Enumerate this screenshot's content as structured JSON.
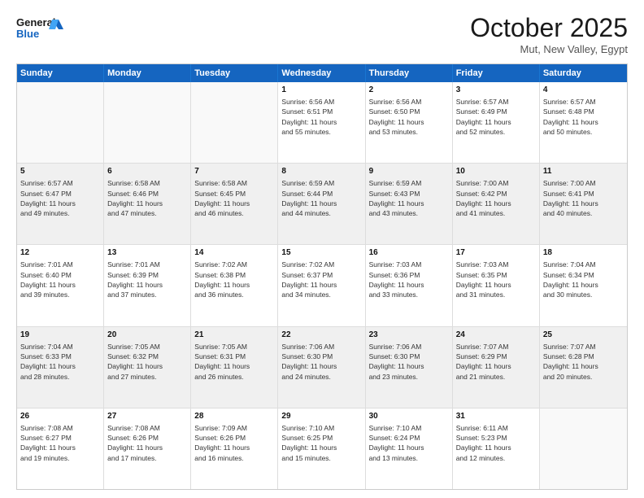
{
  "header": {
    "logo_line1": "General",
    "logo_line2": "Blue",
    "month": "October 2025",
    "location": "Mut, New Valley, Egypt"
  },
  "days_of_week": [
    "Sunday",
    "Monday",
    "Tuesday",
    "Wednesday",
    "Thursday",
    "Friday",
    "Saturday"
  ],
  "weeks": [
    [
      {
        "day": "",
        "text": ""
      },
      {
        "day": "",
        "text": ""
      },
      {
        "day": "",
        "text": ""
      },
      {
        "day": "1",
        "text": "Sunrise: 6:56 AM\nSunset: 6:51 PM\nDaylight: 11 hours\nand 55 minutes."
      },
      {
        "day": "2",
        "text": "Sunrise: 6:56 AM\nSunset: 6:50 PM\nDaylight: 11 hours\nand 53 minutes."
      },
      {
        "day": "3",
        "text": "Sunrise: 6:57 AM\nSunset: 6:49 PM\nDaylight: 11 hours\nand 52 minutes."
      },
      {
        "day": "4",
        "text": "Sunrise: 6:57 AM\nSunset: 6:48 PM\nDaylight: 11 hours\nand 50 minutes."
      }
    ],
    [
      {
        "day": "5",
        "text": "Sunrise: 6:57 AM\nSunset: 6:47 PM\nDaylight: 11 hours\nand 49 minutes."
      },
      {
        "day": "6",
        "text": "Sunrise: 6:58 AM\nSunset: 6:46 PM\nDaylight: 11 hours\nand 47 minutes."
      },
      {
        "day": "7",
        "text": "Sunrise: 6:58 AM\nSunset: 6:45 PM\nDaylight: 11 hours\nand 46 minutes."
      },
      {
        "day": "8",
        "text": "Sunrise: 6:59 AM\nSunset: 6:44 PM\nDaylight: 11 hours\nand 44 minutes."
      },
      {
        "day": "9",
        "text": "Sunrise: 6:59 AM\nSunset: 6:43 PM\nDaylight: 11 hours\nand 43 minutes."
      },
      {
        "day": "10",
        "text": "Sunrise: 7:00 AM\nSunset: 6:42 PM\nDaylight: 11 hours\nand 41 minutes."
      },
      {
        "day": "11",
        "text": "Sunrise: 7:00 AM\nSunset: 6:41 PM\nDaylight: 11 hours\nand 40 minutes."
      }
    ],
    [
      {
        "day": "12",
        "text": "Sunrise: 7:01 AM\nSunset: 6:40 PM\nDaylight: 11 hours\nand 39 minutes."
      },
      {
        "day": "13",
        "text": "Sunrise: 7:01 AM\nSunset: 6:39 PM\nDaylight: 11 hours\nand 37 minutes."
      },
      {
        "day": "14",
        "text": "Sunrise: 7:02 AM\nSunset: 6:38 PM\nDaylight: 11 hours\nand 36 minutes."
      },
      {
        "day": "15",
        "text": "Sunrise: 7:02 AM\nSunset: 6:37 PM\nDaylight: 11 hours\nand 34 minutes."
      },
      {
        "day": "16",
        "text": "Sunrise: 7:03 AM\nSunset: 6:36 PM\nDaylight: 11 hours\nand 33 minutes."
      },
      {
        "day": "17",
        "text": "Sunrise: 7:03 AM\nSunset: 6:35 PM\nDaylight: 11 hours\nand 31 minutes."
      },
      {
        "day": "18",
        "text": "Sunrise: 7:04 AM\nSunset: 6:34 PM\nDaylight: 11 hours\nand 30 minutes."
      }
    ],
    [
      {
        "day": "19",
        "text": "Sunrise: 7:04 AM\nSunset: 6:33 PM\nDaylight: 11 hours\nand 28 minutes."
      },
      {
        "day": "20",
        "text": "Sunrise: 7:05 AM\nSunset: 6:32 PM\nDaylight: 11 hours\nand 27 minutes."
      },
      {
        "day": "21",
        "text": "Sunrise: 7:05 AM\nSunset: 6:31 PM\nDaylight: 11 hours\nand 26 minutes."
      },
      {
        "day": "22",
        "text": "Sunrise: 7:06 AM\nSunset: 6:30 PM\nDaylight: 11 hours\nand 24 minutes."
      },
      {
        "day": "23",
        "text": "Sunrise: 7:06 AM\nSunset: 6:30 PM\nDaylight: 11 hours\nand 23 minutes."
      },
      {
        "day": "24",
        "text": "Sunrise: 7:07 AM\nSunset: 6:29 PM\nDaylight: 11 hours\nand 21 minutes."
      },
      {
        "day": "25",
        "text": "Sunrise: 7:07 AM\nSunset: 6:28 PM\nDaylight: 11 hours\nand 20 minutes."
      }
    ],
    [
      {
        "day": "26",
        "text": "Sunrise: 7:08 AM\nSunset: 6:27 PM\nDaylight: 11 hours\nand 19 minutes."
      },
      {
        "day": "27",
        "text": "Sunrise: 7:08 AM\nSunset: 6:26 PM\nDaylight: 11 hours\nand 17 minutes."
      },
      {
        "day": "28",
        "text": "Sunrise: 7:09 AM\nSunset: 6:26 PM\nDaylight: 11 hours\nand 16 minutes."
      },
      {
        "day": "29",
        "text": "Sunrise: 7:10 AM\nSunset: 6:25 PM\nDaylight: 11 hours\nand 15 minutes."
      },
      {
        "day": "30",
        "text": "Sunrise: 7:10 AM\nSunset: 6:24 PM\nDaylight: 11 hours\nand 13 minutes."
      },
      {
        "day": "31",
        "text": "Sunrise: 6:11 AM\nSunset: 5:23 PM\nDaylight: 11 hours\nand 12 minutes."
      },
      {
        "day": "",
        "text": ""
      }
    ]
  ]
}
